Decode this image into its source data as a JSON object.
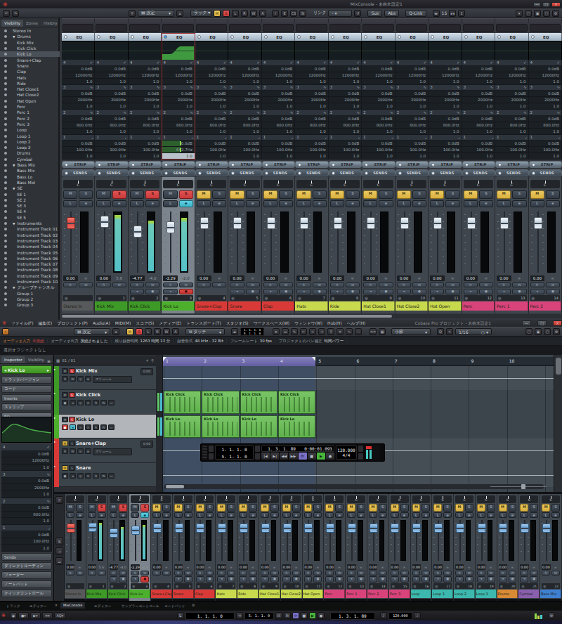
{
  "mixwin": {
    "title": "MixConsole - 名称未設定1",
    "toolbar": {
      "settings": "設定",
      "rack": "ラック",
      "letters": [
        "M",
        "S",
        "L",
        "R",
        "W",
        "A"
      ],
      "letters2": [
        "I",
        "E",
        "CS",
        "SI"
      ],
      "link_label": "リンク",
      "sus": "Sus",
      "abs": "Abs",
      "qlink": "Q-Link",
      "zoom_num": "15"
    },
    "sidebar": {
      "tabs": [
        "Visibility",
        "Zones",
        "History"
      ],
      "items": [
        {
          "label": "Stereo In",
          "kind": "top"
        },
        {
          "label": "Drums",
          "kind": "hdr"
        },
        {
          "label": "Kick Mix",
          "kind": "child"
        },
        {
          "label": "Kick Click",
          "kind": "child"
        },
        {
          "label": "Kick Lo",
          "kind": "child",
          "sel": true
        },
        {
          "label": "Snare+Clap",
          "kind": "child"
        },
        {
          "label": "Snare",
          "kind": "child"
        },
        {
          "label": "Clap",
          "kind": "child"
        },
        {
          "label": "Hats",
          "kind": "child"
        },
        {
          "label": "Ride",
          "kind": "child"
        },
        {
          "label": "Hat Close1",
          "kind": "child"
        },
        {
          "label": "Hat Close2",
          "kind": "child"
        },
        {
          "label": "Hat Open",
          "kind": "child"
        },
        {
          "label": "Perc",
          "kind": "child"
        },
        {
          "label": "Perc 1",
          "kind": "child"
        },
        {
          "label": "Perc 2",
          "kind": "child"
        },
        {
          "label": "Perc 3",
          "kind": "child"
        },
        {
          "label": "Loop",
          "kind": "child"
        },
        {
          "label": "Loop 1",
          "kind": "child"
        },
        {
          "label": "Loop 2",
          "kind": "child"
        },
        {
          "label": "Loop 3",
          "kind": "child"
        },
        {
          "label": "Drums",
          "kind": "child"
        },
        {
          "label": "Cymbal",
          "kind": "child"
        },
        {
          "label": "Bass Mix",
          "kind": "hdr"
        },
        {
          "label": "Bass Mix",
          "kind": "child"
        },
        {
          "label": "Bass Lo",
          "kind": "child"
        },
        {
          "label": "Bass Mid",
          "kind": "child"
        },
        {
          "label": "SE",
          "kind": "hdr"
        },
        {
          "label": "SE 1",
          "kind": "child"
        },
        {
          "label": "SE 2",
          "kind": "child"
        },
        {
          "label": "SE 3",
          "kind": "child"
        },
        {
          "label": "SE 4",
          "kind": "child"
        },
        {
          "label": "SE 5",
          "kind": "child"
        },
        {
          "label": "Instruments",
          "kind": "hdr"
        },
        {
          "label": "Instrument Track 01",
          "kind": "child"
        },
        {
          "label": "Instrument Track 02",
          "kind": "child"
        },
        {
          "label": "Instrument Track 03",
          "kind": "child"
        },
        {
          "label": "Instrument Track 04",
          "kind": "child"
        },
        {
          "label": "Instrument Track 05",
          "kind": "child"
        },
        {
          "label": "Instrument Track 06",
          "kind": "child"
        },
        {
          "label": "Instrument Track 07",
          "kind": "child"
        },
        {
          "label": "Instrument Track 08",
          "kind": "child"
        },
        {
          "label": "Instrument Track 09",
          "kind": "child"
        },
        {
          "label": "Instrument Track 10",
          "kind": "child"
        },
        {
          "label": "グループチャンネル",
          "kind": "hdr"
        },
        {
          "label": "Group 1",
          "kind": "child"
        },
        {
          "label": "Group 2",
          "kind": "child"
        },
        {
          "label": "Group 3",
          "kind": "child"
        }
      ]
    },
    "rack": {
      "eq": "EQ",
      "strip": "STRIP",
      "sends": "SENDS",
      "sel_freq": "642.7Hz",
      "bands": [
        {
          "n": "4",
          "icon": "✓",
          "gain": "0.0dB",
          "freq": "12000Hz",
          "q": "1.0"
        },
        {
          "n": "3",
          "icon": "∿",
          "gain": "0.0dB",
          "freq": "2000Hz",
          "q": "1.0"
        },
        {
          "n": "2",
          "icon": "∿",
          "gain": "0.0dB",
          "freq": "800.0Hz",
          "q": "1.0"
        },
        {
          "n": "1",
          "icon": "◞",
          "gain": "0.0dB",
          "freq": "100.0Hz",
          "q": "1.0"
        }
      ]
    }
  },
  "channels": [
    {
      "name": "Stereo In",
      "num": "",
      "color": "#58595b",
      "cap": "red",
      "fader": 0.21,
      "meter": 0,
      "val": "0.00",
      "peak": "∞",
      "mute": false,
      "solo": false,
      "monrec": false
    },
    {
      "name": "Kick Mix",
      "num": "1",
      "color": "#3e9a26",
      "cap": "w",
      "fader": 0.18,
      "meter": 0.98,
      "val": "0.00",
      "peak": "5.6",
      "mute": false,
      "solo": true,
      "monrec": false
    },
    {
      "name": "Kick Click",
      "num": "2",
      "color": "#3e9a26",
      "cap": "w",
      "fader": 0.38,
      "meter": 0.88,
      "val": "-4.77",
      "peak": "-4.0",
      "mute": false,
      "solo": true,
      "monrec": true
    },
    {
      "name": "Kick Lo",
      "num": "3",
      "color": "#4cb02c",
      "cap": "w",
      "fader": 0.29,
      "meter": 0.93,
      "val": "-2.29",
      "peak": "-2.0",
      "mute": false,
      "solo": true,
      "monrec": true,
      "sel": true,
      "rec": true
    },
    {
      "name": "Snare+Clap",
      "num": "4",
      "color": "#d93a38",
      "cap": "w",
      "fader": 0.21,
      "meter": 0,
      "val": "0.00",
      "peak": "∞",
      "mute": true,
      "solo": false,
      "monrec": false
    },
    {
      "name": "Snare",
      "num": "5",
      "color": "#d93a38",
      "cap": "w",
      "fader": 0.21,
      "meter": 0,
      "val": "0.00",
      "peak": "∞",
      "mute": true,
      "solo": false,
      "monrec": true
    },
    {
      "name": "Clap",
      "num": "6",
      "color": "#d93a38",
      "cap": "w",
      "fader": 0.21,
      "meter": 0,
      "val": "0.00",
      "peak": "∞",
      "mute": true,
      "solo": false,
      "monrec": true
    },
    {
      "name": "Hats",
      "num": "7",
      "color": "#c9d94e",
      "cap": "w",
      "fader": 0.21,
      "meter": 0,
      "val": "0.00",
      "peak": "∞",
      "mute": true,
      "solo": false,
      "monrec": true
    },
    {
      "name": "Ride",
      "num": "8",
      "color": "#c9d94e",
      "cap": "w",
      "fader": 0.21,
      "meter": 0,
      "val": "0.00",
      "peak": "∞",
      "mute": true,
      "solo": false,
      "monrec": true
    },
    {
      "name": "Hat Close1",
      "num": "9",
      "color": "#c9d94e",
      "cap": "w",
      "fader": 0.21,
      "meter": 0,
      "val": "0.00",
      "peak": "∞",
      "mute": true,
      "solo": false,
      "monrec": true
    },
    {
      "name": "Hat Close2",
      "num": "10",
      "color": "#c9d94e",
      "cap": "w",
      "fader": 0.21,
      "meter": 0,
      "val": "0.00",
      "peak": "∞",
      "mute": true,
      "solo": false,
      "monrec": true
    },
    {
      "name": "Hat Open",
      "num": "11",
      "color": "#c9d94e",
      "cap": "w",
      "fader": 0.21,
      "meter": 0,
      "val": "0.00",
      "peak": "∞",
      "mute": true,
      "solo": false,
      "monrec": true
    },
    {
      "name": "Perc",
      "num": "12",
      "color": "#d8437a",
      "cap": "w",
      "fader": 0.21,
      "meter": 0,
      "val": "0.00",
      "peak": "∞",
      "mute": true,
      "solo": false,
      "monrec": true
    },
    {
      "name": "Perc 1",
      "num": "13",
      "color": "#d8437a",
      "cap": "w",
      "fader": 0.21,
      "meter": 0,
      "val": "0.00",
      "peak": "∞",
      "mute": true,
      "solo": false,
      "monrec": true
    },
    {
      "name": "Perc 2",
      "num": "14",
      "color": "#d8437a",
      "cap": "w",
      "fader": 0.21,
      "meter": 0,
      "val": "0.00",
      "peak": "∞",
      "mute": true,
      "solo": false,
      "monrec": true
    },
    {
      "name": "Perc 3",
      "num": "15",
      "color": "#d8437a",
      "cap": "w",
      "fader": 0.21,
      "meter": 0,
      "val": "0.00",
      "peak": "∞",
      "mute": true,
      "solo": false,
      "monrec": true
    },
    {
      "name": "Loop",
      "num": "16",
      "color": "#3cb8ae",
      "cap": "w",
      "fader": 0.21,
      "meter": 0,
      "val": "0.00",
      "peak": "∞",
      "mute": true,
      "solo": false,
      "monrec": true
    },
    {
      "name": "Loop 1",
      "num": "17",
      "color": "#3cb8ae",
      "cap": "w",
      "fader": 0.21,
      "meter": 0,
      "val": "0.00",
      "peak": "∞",
      "mute": true,
      "solo": false,
      "monrec": true
    },
    {
      "name": "Loop 2",
      "num": "18",
      "color": "#3cb8ae",
      "cap": "w",
      "fader": 0.21,
      "meter": 0,
      "val": "0.00",
      "peak": "∞",
      "mute": true,
      "solo": false,
      "monrec": true
    },
    {
      "name": "Loop 3",
      "num": "19",
      "color": "#3cb8ae",
      "cap": "w",
      "fader": 0.21,
      "meter": 0,
      "val": "0.00",
      "peak": "∞",
      "mute": true,
      "solo": false,
      "monrec": true
    },
    {
      "name": "Drums",
      "num": "20",
      "color": "#d98a35",
      "cap": "w",
      "fader": 0.21,
      "meter": 0,
      "val": "0.00",
      "peak": "∞",
      "mute": true,
      "solo": false,
      "monrec": true
    },
    {
      "name": "Cymbal",
      "num": "21",
      "color": "#8a5fae",
      "cap": "w",
      "fader": 0.21,
      "meter": 0,
      "val": "0.00",
      "peak": "∞",
      "mute": true,
      "solo": false,
      "monrec": true
    },
    {
      "name": "Bass Mix",
      "num": "22",
      "color": "#3f7fd0",
      "cap": "w",
      "fader": 0.21,
      "meter": 0,
      "val": "0.00",
      "peak": "∞",
      "mute": true,
      "solo": false,
      "monrec": false
    }
  ],
  "projwin": {
    "menus": [
      "ファイル(F)",
      "編集(E)",
      "プロジェクト(P)",
      "Audio(A)",
      "MIDI(M)",
      "スコア(S)",
      "メディア(E)",
      "トランスポート(T)",
      "スタジオ(S)",
      "ワークスペース(W)",
      "ウィンドウ(W)",
      "Hub(H)",
      "ヘルプ(H)"
    ],
    "title": "Cubase Pro プロジェクト - 名称未設定1",
    "toolbar": {
      "settings": "設定",
      "touch": "タッチ",
      "letters": [
        "M",
        "S",
        "L",
        "R",
        "W",
        "A"
      ],
      "bar": "小節",
      "quant": "1/16",
      "time1": "1. 1. 1. 0",
      "time2": "5. 1. 1. 0"
    },
    "status": [
      {
        "label": "オーディオ入力",
        "value": "未接続",
        "warn": true
      },
      {
        "label": "オーディオ出力",
        "value": "接続されました"
      },
      {
        "label": "残り録音時間",
        "value": "1263 時間 13 分"
      },
      {
        "label": "録音形式",
        "value": "48 kHz - 32 Bit"
      },
      {
        "label": "フレームレート",
        "value": "30 fps"
      },
      {
        "label": "プロジェクトのパン補正",
        "value": "時間パワー"
      }
    ],
    "info_line": "選択オブジェクトなし",
    "inspector": {
      "tabs": [
        "Inspector",
        "Visibility"
      ],
      "track_name": "Kick Lo",
      "sections": [
        "トラックバージョン",
        "コード",
        "Inserts",
        "ストリップ",
        "EQ"
      ],
      "sections2": [
        "Sends",
        "ダイレクトルーティン",
        "フェーダー",
        "ノートパッド",
        "クイックコントロール"
      ]
    },
    "tracklist": {
      "counter": "81 / 81",
      "volume_label": "ボリューム",
      "tracks": [
        {
          "name": "Kick Mix",
          "color": "#3e9a26",
          "kind": "group",
          "solo": true,
          "value": "0.00"
        },
        {
          "name": "Kick Click",
          "color": "#3e9a26",
          "kind": "midi",
          "solo": true
        },
        {
          "name": "Kick Lo",
          "color": "#4cb02c",
          "kind": "midi",
          "solo": true,
          "sel": true,
          "rec": true
        },
        {
          "name": "Snare+Clap",
          "color": "#d93a38",
          "kind": "group",
          "mute": true,
          "value": "0.00"
        },
        {
          "name": "Snare",
          "color": "#d93a38",
          "kind": "midi",
          "mute": true
        }
      ]
    },
    "ruler_bars": [
      "1",
      "2",
      "3",
      "4",
      "5",
      "6",
      "7",
      "8",
      "9",
      "10"
    ],
    "parts": {
      "kick_click": [
        "Kick Click",
        "Kick Click",
        "Kick Click",
        "Kick Click"
      ],
      "kick_lo": [
        "Kick Lo",
        "Kick Lo",
        "Kick Lo",
        "Kick Lo"
      ]
    },
    "transport": {
      "loc_l": "1. 1. 1. 0",
      "loc_r": "5. 1. 1. 0",
      "pos": "1. 3. 1. 89",
      "time": "0:00:01.093",
      "tempo": "120.000",
      "sig": "4/4"
    },
    "zone_tabs": {
      "left": [
        "トラック",
        "エディター"
      ],
      "lower": [
        "MixConsole",
        "エディター",
        "サンプラーコントロール",
        "コードパッド"
      ],
      "active": "MixConsole"
    },
    "bottom": {
      "aq": "AQ",
      "pos": "1. 3. 1. 89",
      "tempo": "120.000",
      "loc_l": "1. 1. 1. 0",
      "loc_r": "5. 1. 1. 0"
    }
  }
}
